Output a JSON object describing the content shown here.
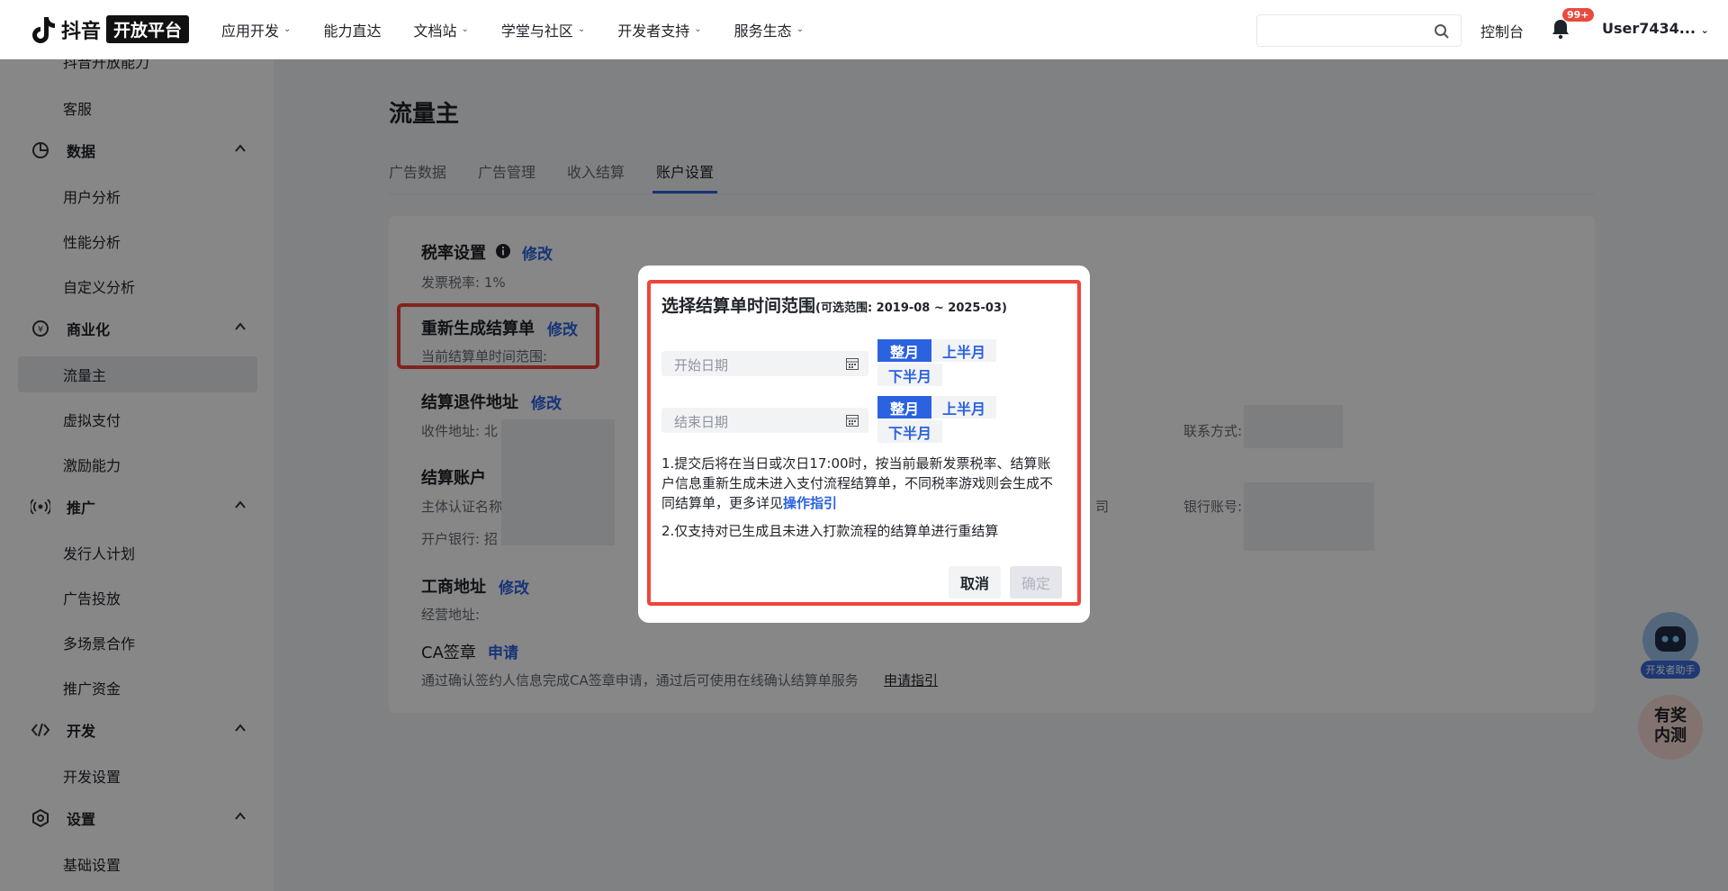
{
  "header": {
    "logo_text": "抖音",
    "logo_badge": "开放平台",
    "nav": [
      {
        "label": "应用开发",
        "caret": true
      },
      {
        "label": "能力直达",
        "caret": false
      },
      {
        "label": "文档站",
        "caret": true
      },
      {
        "label": "学堂与社区",
        "caret": true
      },
      {
        "label": "开发者支持",
        "caret": true
      },
      {
        "label": "服务生态",
        "caret": true
      }
    ],
    "search_placeholder": "",
    "console": "控制台",
    "notification_badge": "99+",
    "user": "User7434..."
  },
  "sidebar": {
    "items": [
      {
        "type": "sub",
        "label": "抖音开放能力"
      },
      {
        "type": "sub",
        "label": "客服"
      },
      {
        "type": "group",
        "label": "数据",
        "icon": "pie-chart-icon"
      },
      {
        "type": "sub",
        "label": "用户分析"
      },
      {
        "type": "sub",
        "label": "性能分析"
      },
      {
        "type": "sub",
        "label": "自定义分析"
      },
      {
        "type": "group",
        "label": "商业化",
        "icon": "yen-icon"
      },
      {
        "type": "sub",
        "label": "流量主",
        "active": true
      },
      {
        "type": "sub",
        "label": "虚拟支付"
      },
      {
        "type": "sub",
        "label": "激励能力"
      },
      {
        "type": "group",
        "label": "推广",
        "icon": "broadcast-icon"
      },
      {
        "type": "sub",
        "label": "发行人计划"
      },
      {
        "type": "sub",
        "label": "广告投放"
      },
      {
        "type": "sub",
        "label": "多场景合作"
      },
      {
        "type": "sub",
        "label": "推广资金"
      },
      {
        "type": "group",
        "label": "开发",
        "icon": "code-icon"
      },
      {
        "type": "sub",
        "label": "开发设置"
      },
      {
        "type": "group",
        "label": "设置",
        "icon": "settings-icon"
      },
      {
        "type": "sub",
        "label": "基础设置"
      }
    ]
  },
  "main": {
    "title": "流量主",
    "tabs": [
      "广告数据",
      "广告管理",
      "收入结算",
      "账户设置"
    ],
    "active_tab": "账户设置",
    "tax": {
      "title": "税率设置",
      "action": "修改",
      "text": "发票税率: 1%"
    },
    "regen": {
      "title": "重新生成结算单",
      "action": "修改",
      "text": "当前结算单时间范围:"
    },
    "return_address": {
      "title": "结算退件地址",
      "action": "修改",
      "text_label": "收件地址: 北",
      "contact_label": "联系方式:"
    },
    "settlement_account": {
      "title": "结算账户",
      "subject_label": "主体认证名称",
      "bank_label": "开户银行: 招",
      "account_label": "银行账号:",
      "partial": "司"
    },
    "business_address": {
      "title": "工商地址",
      "action": "修改",
      "text": "经营地址:"
    },
    "ca": {
      "title": "CA签章",
      "action": "申请",
      "text": "通过确认签约人信息完成CA签章申请，通过后可使用在线确认结算单服务",
      "link": "申请指引"
    }
  },
  "modal": {
    "title": "选择结算单时间范围",
    "range": "(可选范围: 2019-08 ~ 2025-03)",
    "start_placeholder": "开始日期",
    "end_placeholder": "结束日期",
    "seg_full": "整月",
    "seg_first": "上半月",
    "seg_second": "下半月",
    "note1": "1.提交后将在当日或次日17:00时，按当前最新发票税率、结算账户信息重新生成未进入支付流程结算单，不同税率游戏则会生成不同结算单，更多详见",
    "note1_link": "操作指引",
    "note2": "2.仅支持对已生成且未进入打款流程的结算单进行重结算",
    "cancel": "取消",
    "ok": "确定"
  },
  "widgets": {
    "assistant": "开发者助手",
    "beta_line1": "有奖",
    "beta_line2": "内测"
  }
}
